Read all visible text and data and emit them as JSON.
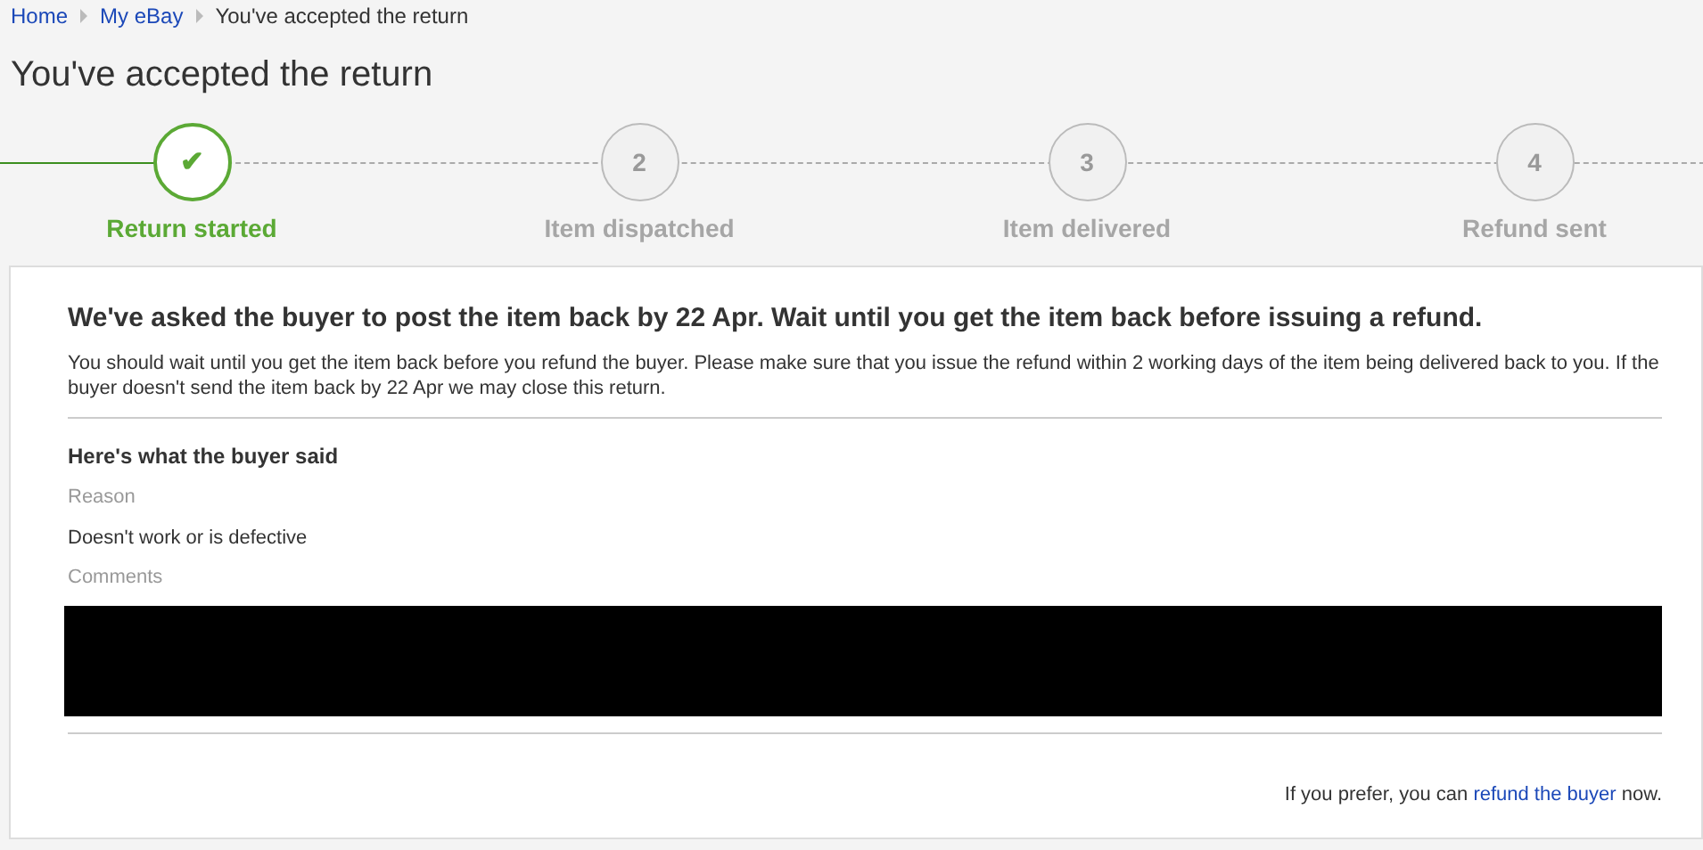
{
  "breadcrumb": [
    {
      "label": "Home",
      "link": true
    },
    {
      "label": "My eBay",
      "link": true
    },
    {
      "label": "You've accepted the return",
      "link": false
    }
  ],
  "title": "You've accepted the return",
  "steps": [
    {
      "label": "Return started",
      "marker": "✔",
      "done": true
    },
    {
      "label": "Item dispatched",
      "marker": "2",
      "done": false
    },
    {
      "label": "Item delivered",
      "marker": "3",
      "done": false
    },
    {
      "label": "Refund sent",
      "marker": "4",
      "done": false
    }
  ],
  "panel": {
    "heading": "We've asked the buyer to post the item back by 22 Apr. Wait until you get the item back before issuing a refund.",
    "body": "You should wait until you get the item back before you refund the buyer. Please make sure that you issue the refund within 2 working days of the item being delivered back to you. If the buyer doesn't send the item back by 22 Apr we may close this return.",
    "section_title": "Here's what the buyer said",
    "reason_label": "Reason",
    "reason": "Doesn't work or is defective",
    "comments_label": "Comments",
    "comments_redacted": true,
    "footer": {
      "before": "If you prefer, you can ",
      "link": "refund the buyer",
      "after": " now."
    }
  }
}
